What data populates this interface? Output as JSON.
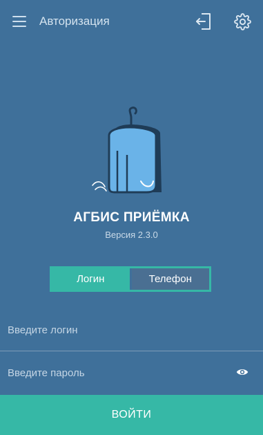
{
  "appbar": {
    "title": "Авторизация",
    "menu_icon": "hamburger-menu-icon",
    "logout_icon": "logout-icon",
    "settings_icon": "gear-icon"
  },
  "branding": {
    "app_name": "АГБИС ПРИЁМКА",
    "version": "Версия 2.3.0",
    "logo_icon": "garment-on-hanger-logo"
  },
  "auth_mode": {
    "options": [
      "Логин",
      "Телефон"
    ],
    "selected": "Логин"
  },
  "form": {
    "login_placeholder": "Введите логин",
    "login_value": "",
    "password_placeholder": "Введите пароль",
    "password_value": "",
    "eye_icon": "show-password-eye-icon"
  },
  "actions": {
    "submit_label": "ВОЙТИ"
  },
  "colors": {
    "background": "#3f709a",
    "accent": "#36b8a6",
    "logo_fill": "#6ab3e8",
    "logo_outline": "#1f3c57"
  }
}
